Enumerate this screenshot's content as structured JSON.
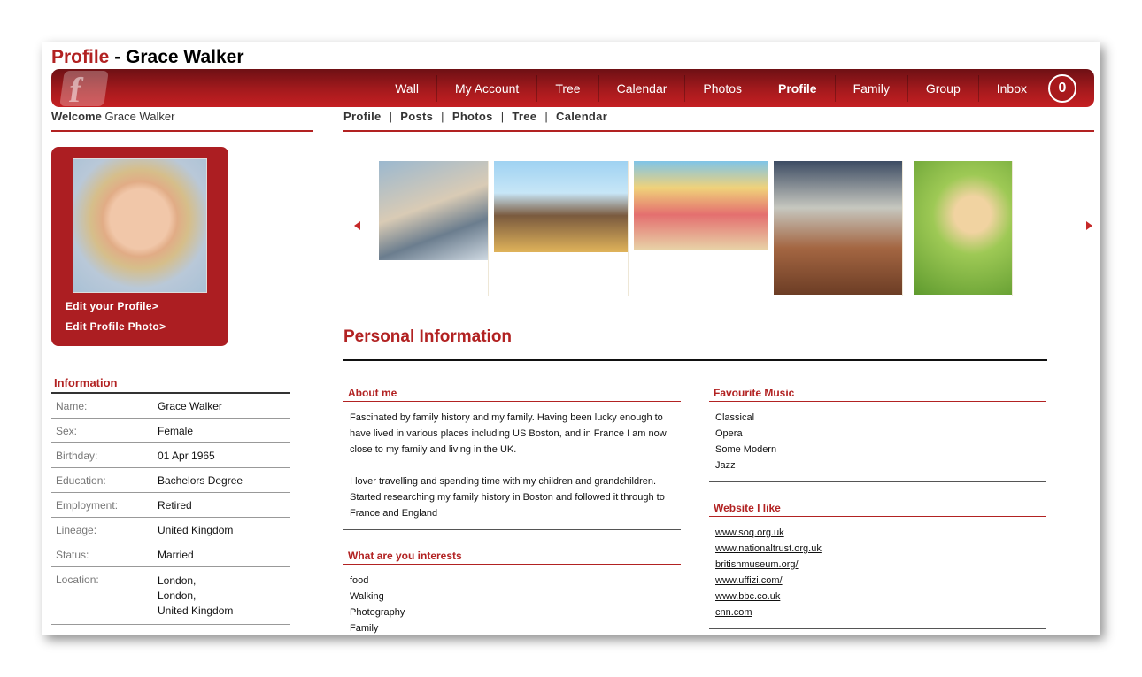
{
  "header": {
    "title_prefix": "Profile",
    "title_suffix": " - Grace Walker"
  },
  "nav": {
    "items": [
      "Wall",
      "My Account",
      "Tree",
      "Calendar",
      "Photos",
      "Profile",
      "Family",
      "Group",
      "Inbox"
    ],
    "active": "Profile",
    "inbox_count": "0"
  },
  "welcome": {
    "label": "Welcome",
    "name": "Grace Walker"
  },
  "subnav": [
    "Profile",
    "Posts",
    "Photos",
    "Tree",
    "Calendar"
  ],
  "profile_box": {
    "edit_profile": "Edit your Profile>",
    "edit_photo": "Edit Profile Photo>"
  },
  "information": {
    "title": "Information",
    "rows": [
      {
        "k": "Name:",
        "v": "Grace Walker"
      },
      {
        "k": "Sex:",
        "v": "Female"
      },
      {
        "k": "Birthday:",
        "v": "01 Apr 1965"
      },
      {
        "k": "Education:",
        "v": "Bachelors Degree"
      },
      {
        "k": "Employment:",
        "v": "Retired"
      },
      {
        "k": "Lineage:",
        "v": "United Kingdom"
      },
      {
        "k": "Status:",
        "v": "Married"
      },
      {
        "k": "Location:",
        "v": "London,\nLondon,\nUnited Kingdom"
      }
    ]
  },
  "personal": {
    "title": "Personal Information",
    "about": {
      "title": "About me",
      "p1": "Fascinated by family history and my family. Having been lucky enough to have lived in various places including US Boston, and in France I am now close to my family and living in the UK.",
      "p2": "I lover travelling and spending time with my children and grandchildren. Started researching my family history in Boston and followed it through to France and England"
    },
    "interests": {
      "title": "What are you interests",
      "items": [
        "food",
        "Walking",
        "Photography",
        "Family"
      ]
    },
    "music": {
      "title": "Favourite Music",
      "items": [
        "Classical",
        "Opera",
        "Some Modern",
        "Jazz"
      ]
    },
    "websites": {
      "title": "Website I like",
      "items": [
        "www.soq.org.uk",
        "www.nationaltrust.org.uk",
        "britishmuseum.org/",
        "www.uffizi.com/",
        "www.bbc.co.uk",
        "cnn.com"
      ]
    }
  },
  "colors": {
    "accent": "#b22222",
    "nav_dark": "#6e1014",
    "nav_light": "#c51f22"
  }
}
